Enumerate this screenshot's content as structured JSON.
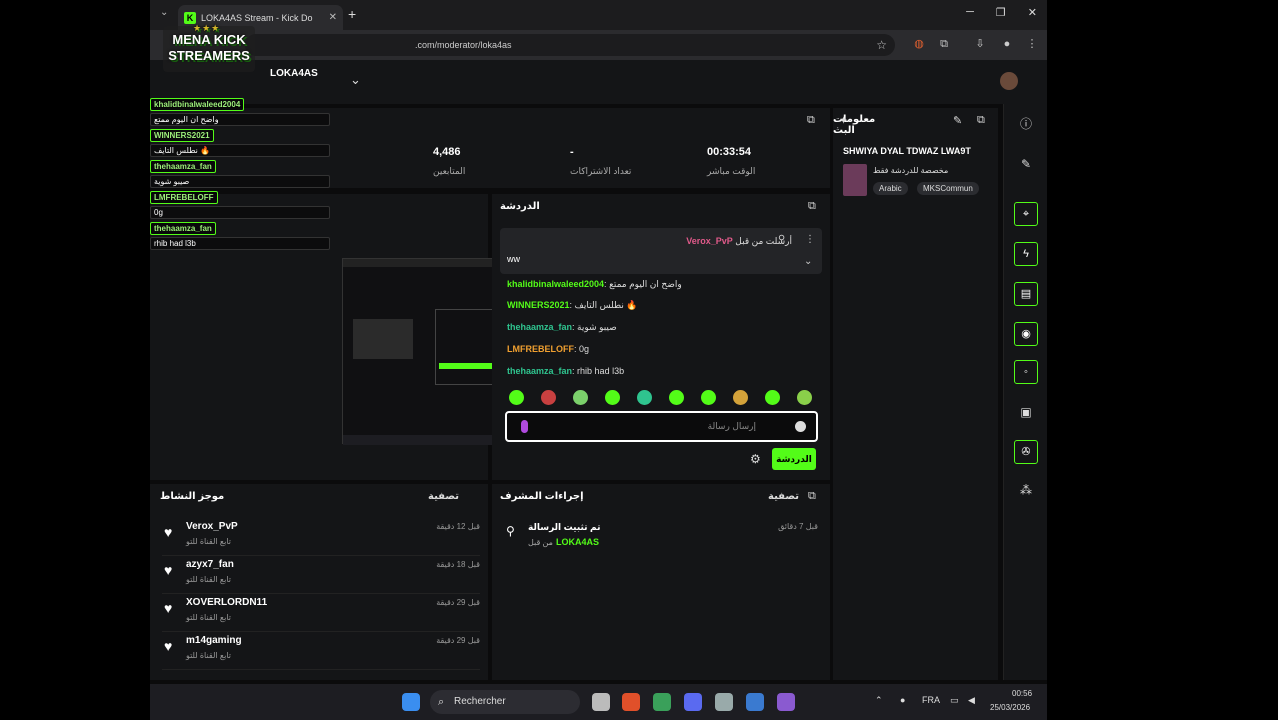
{
  "browser": {
    "tab_title": "LOKA4AS Stream - Kick Do",
    "url_suffix": ".com/moderator/loka4as"
  },
  "overlay": {
    "logo_line1": "MENA KICK",
    "logo_line2": "STREAMERS",
    "chat": [
      {
        "name": "khalidbinalwaleed2004",
        "msg": "واضح ان اليوم ممتع"
      },
      {
        "name": "WINNERS2021",
        "msg": "نطلس التايف 🔥"
      },
      {
        "name": "thehaamza_fan",
        "msg": "صيبو شوية"
      },
      {
        "name": "LMFREBELOFF",
        "msg": "0g"
      },
      {
        "name": "thehaamza_fan",
        "msg": "rhib had l3b"
      }
    ]
  },
  "header": {
    "channel": "LOKA4AS"
  },
  "stats": [
    {
      "value": "4,486",
      "label": "المتابعين"
    },
    {
      "value": "-",
      "label": "تعداد الاشتراكات"
    },
    {
      "value": "00:33:54",
      "label": "الوقت مباشر"
    }
  ],
  "info": {
    "title": "معلومات البث",
    "stream_title": "SHWIYA DYAL TDWAZ LWA9T",
    "tagline": "مخصصة للدردشة فقط",
    "tags": [
      "Arabic",
      "MKSCommun"
    ]
  },
  "chat": {
    "title": "الدردشة",
    "pinned_by_label": "أرسلت من قبل",
    "pinned_by": "Verox_PvP",
    "pinned_msg": "ww",
    "messages": [
      {
        "user": "khalidbinalwaleed2004",
        "text": "واضح ان اليوم ممتع",
        "color": "#53fc18"
      },
      {
        "user": "WINNERS2021",
        "text": "نطلس التايف 🔥",
        "color": "#53fc18"
      },
      {
        "user": "thehaamza_fan",
        "text": "صيبو شوية",
        "color": "#2fc48f"
      },
      {
        "user": "LMFREBELOFF",
        "text": "0g",
        "color": "#f0a030"
      },
      {
        "user": "thehaamza_fan",
        "text": "rhib had l3b",
        "color": "#2fc48f"
      }
    ],
    "placeholder": "إرسال رسالة",
    "send_label": "الدردشة"
  },
  "activity": {
    "title": "موجز النشاط",
    "filter": "تصفية",
    "items": [
      {
        "name": "Verox_PvP",
        "sub": "تابع القناة للتو",
        "time": "قبل 12 دقيقة"
      },
      {
        "name": "azyx7_fan",
        "sub": "تابع القناة للتو",
        "time": "قبل 18 دقيقة"
      },
      {
        "name": "XOVERLORDN11",
        "sub": "تابع القناة للتو",
        "time": "قبل 29 دقيقة"
      },
      {
        "name": "m14gaming",
        "sub": "تابع القناة للتو",
        "time": "قبل 29 دقيقة"
      }
    ]
  },
  "modactions": {
    "title": "إجراءات المشرف",
    "filter": "تصفية",
    "action": "تم تثبيت الرسالة",
    "by_label": "من قبل",
    "by": "LOKA4AS",
    "time": "قبل 7 دقائق"
  },
  "taskbar": {
    "search": "Rechercher",
    "lang": "FRA",
    "time": "00:56",
    "date": "25/03/2026"
  }
}
